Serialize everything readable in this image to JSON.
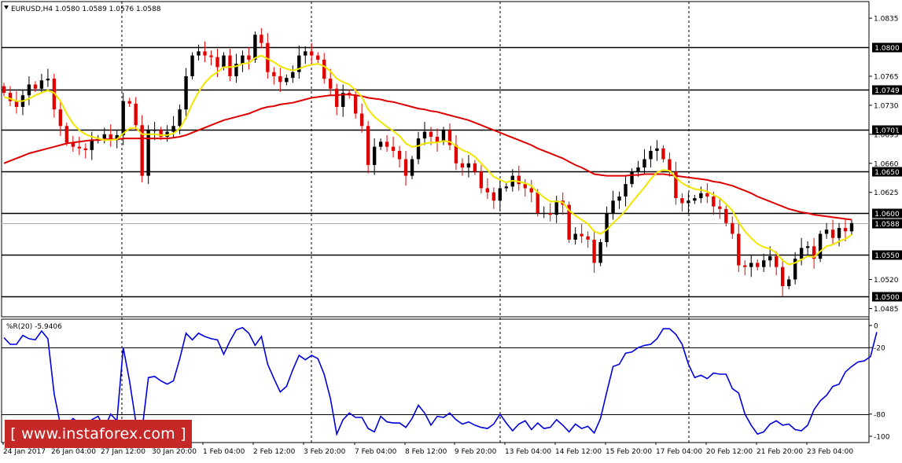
{
  "chart_data": [
    {
      "type": "candlestick",
      "header": "EURUSD,H4  1.0580 1.0589 1.0576 1.0588",
      "symbol": "EURUSD",
      "timeframe": "H4",
      "last_bar": {
        "open": 1.058,
        "high": 1.0589,
        "low": 1.0576,
        "close": 1.0588
      },
      "ylim": [
        1.0475,
        1.0855
      ],
      "y_ticks": [
        "1.0835",
        "1.0765",
        "1.0730",
        "1.0695",
        "1.0660",
        "1.0625",
        "1.0520",
        "1.0485"
      ],
      "x_ticks": [
        "24 Jan 2017",
        "26 Jan 04:00",
        "27 Jan 12:00",
        "30 Jan 20:00",
        "1 Feb 04:00",
        "2 Feb 12:00",
        "3 Feb 20:00",
        "7 Feb 04:00",
        "8 Feb 12:00",
        "9 Feb 20:00",
        "13 Feb 04:00",
        "14 Feb 12:00",
        "15 Feb 20:00",
        "17 Feb 04:00",
        "20 Feb 12:00",
        "21 Feb 20:00",
        "23 Feb 04:00"
      ],
      "horizontal_levels": [
        "1.0800",
        "1.0749",
        "1.0701",
        "1.0650",
        "1.0600",
        "1.0550",
        "1.0500"
      ],
      "current_price": "1.0588",
      "up_color": "#000000",
      "down_color": "#e00000",
      "fast_ma_color": "#f2e600",
      "slow_ma_color": "#dd0000",
      "grid": false,
      "close": [
        1.0745,
        1.0735,
        1.0728,
        1.0742,
        1.0755,
        1.075,
        1.076,
        1.0762,
        1.0725,
        1.0705,
        1.0685,
        1.068,
        1.0678,
        1.0676,
        1.0688,
        1.069,
        1.0695,
        1.0688,
        1.0694,
        1.0735,
        1.0732,
        1.0706,
        1.0645,
        1.07,
        1.07,
        1.0692,
        1.0698,
        1.0705,
        1.0725,
        1.0765,
        1.079,
        1.0795,
        1.079,
        1.0788,
        1.0776,
        1.079,
        1.0765,
        1.078,
        1.079,
        1.0785,
        1.0815,
        1.0805,
        1.077,
        1.0765,
        1.0758,
        1.0763,
        1.077,
        1.079,
        1.0795,
        1.079,
        1.0785,
        1.0762,
        1.075,
        1.0728,
        1.0745,
        1.0742,
        1.072,
        1.0705,
        1.0658,
        1.068,
        1.0686,
        1.068,
        1.0675,
        1.0665,
        1.0645,
        1.0665,
        1.069,
        1.0698,
        1.0692,
        1.0686,
        1.07,
        1.0682,
        1.066,
        1.0655,
        1.066,
        1.065,
        1.063,
        1.0625,
        1.0615,
        1.063,
        1.0632,
        1.0645,
        1.0635,
        1.063,
        1.0625,
        1.06,
        1.06,
        1.0598,
        1.0615,
        1.061,
        1.0568,
        1.0575,
        1.0572,
        1.0568,
        1.054,
        1.0565,
        1.06,
        1.0615,
        1.062,
        1.0635,
        1.065,
        1.0655,
        1.0665,
        1.0675,
        1.0678,
        1.0665,
        1.065,
        1.0618,
        1.0612,
        1.0615,
        1.0618,
        1.0624,
        1.062,
        1.0608,
        1.0605,
        1.0588,
        1.0575,
        1.0537,
        1.0535,
        1.054,
        1.0535,
        1.0543,
        1.0548,
        1.0535,
        1.0512,
        1.052,
        1.0545,
        1.0558,
        1.056,
        1.0545,
        1.0575,
        1.058,
        1.057,
        1.0582,
        1.0578,
        1.0588
      ],
      "fast_ma": [
        1.074,
        1.0738,
        1.0735,
        1.0735,
        1.0738,
        1.0742,
        1.0745,
        1.0748,
        1.0745,
        1.0735,
        1.072,
        1.0708,
        1.07,
        1.0695,
        1.0692,
        1.069,
        1.0688,
        1.0688,
        1.0689,
        1.0696,
        1.0702,
        1.0703,
        1.0695,
        1.0695,
        1.0695,
        1.0694,
        1.0694,
        1.0696,
        1.0702,
        1.0715,
        1.0732,
        1.0746,
        1.0757,
        1.0765,
        1.077,
        1.0776,
        1.0776,
        1.0777,
        1.078,
        1.0781,
        1.0787,
        1.079,
        1.0786,
        1.0782,
        1.0777,
        1.0774,
        1.0772,
        1.0774,
        1.0777,
        1.0779,
        1.078,
        1.0777,
        1.0771,
        1.0762,
        1.0758,
        1.0755,
        1.0748,
        1.074,
        1.0725,
        1.0716,
        1.071,
        1.0704,
        1.0699,
        1.0693,
        1.0684,
        1.068,
        1.0681,
        1.0684,
        1.0685,
        1.0685,
        1.0687,
        1.0686,
        1.0681,
        1.0676,
        1.0673,
        1.0668,
        1.066,
        1.0652,
        1.0644,
        1.064,
        1.0637,
        1.0639,
        1.0638,
        1.0636,
        1.0633,
        1.0625,
        1.0619,
        1.0614,
        1.0614,
        1.0613,
        1.0603,
        1.0597,
        1.0592,
        1.0587,
        1.0578,
        1.0575,
        1.058,
        1.0588,
        1.0595,
        1.0603,
        1.0613,
        1.0622,
        1.0631,
        1.0641,
        1.0649,
        1.0652,
        1.0651,
        1.0643,
        1.0636,
        1.0632,
        1.0629,
        1.0628,
        1.0626,
        1.0622,
        1.0618,
        1.0611,
        1.0603,
        1.0589,
        1.0578,
        1.057,
        1.0563,
        1.0559,
        1.0557,
        1.0552,
        1.0543,
        1.0538,
        1.054,
        1.0544,
        1.0548,
        1.0547,
        1.0554,
        1.056,
        1.0562,
        1.0566,
        1.0569,
        1.0574
      ],
      "slow_ma": [
        1.066,
        1.0663,
        1.0666,
        1.0669,
        1.0672,
        1.0674,
        1.0676,
        1.0678,
        1.068,
        1.0682,
        1.0684,
        1.0685,
        1.0686,
        1.0687,
        1.0688,
        1.0688,
        1.0689,
        1.0689,
        1.0689,
        1.069,
        1.069,
        1.069,
        1.069,
        1.069,
        1.069,
        1.069,
        1.069,
        1.0691,
        1.0692,
        1.0694,
        1.0697,
        1.07,
        1.0703,
        1.0706,
        1.0709,
        1.0712,
        1.0714,
        1.0716,
        1.0718,
        1.072,
        1.0723,
        1.0726,
        1.0728,
        1.0729,
        1.0731,
        1.0732,
        1.0733,
        1.0735,
        1.0737,
        1.0739,
        1.074,
        1.0741,
        1.0742,
        1.0742,
        1.0743,
        1.0743,
        1.0742,
        1.0741,
        1.0739,
        1.0738,
        1.0737,
        1.0735,
        1.0734,
        1.0732,
        1.073,
        1.0728,
        1.0726,
        1.0725,
        1.0723,
        1.0722,
        1.072,
        1.0718,
        1.0716,
        1.0714,
        1.0712,
        1.0709,
        1.0706,
        1.0703,
        1.07,
        1.0697,
        1.0694,
        1.0691,
        1.0688,
        1.0685,
        1.0682,
        1.0678,
        1.0675,
        1.0672,
        1.0669,
        1.0666,
        1.0662,
        1.0658,
        1.0655,
        1.0651,
        1.0647,
        1.0646,
        1.0645,
        1.0645,
        1.0645,
        1.0645,
        1.0646,
        1.0646,
        1.0647,
        1.0647,
        1.0647,
        1.0647,
        1.0646,
        1.0645,
        1.0644,
        1.0643,
        1.0642,
        1.0641,
        1.064,
        1.0638,
        1.0637,
        1.0635,
        1.0633,
        1.063,
        1.0627,
        1.0624,
        1.062,
        1.0617,
        1.0614,
        1.0611,
        1.0608,
        1.0605,
        1.0603,
        1.0601,
        1.06,
        1.0598,
        1.0597,
        1.0596,
        1.0595,
        1.0594,
        1.0593,
        1.0592
      ]
    },
    {
      "type": "line",
      "header": "%R(20) -5.9406",
      "name": "%R(20)",
      "ylim": [
        -100,
        0
      ],
      "y_ticks": [
        "0",
        "-20",
        "-80",
        "-100"
      ],
      "levels": [
        -20,
        -80
      ],
      "color": "#0000dd",
      "values": [
        -11,
        -17,
        -17,
        -9,
        -12,
        -13,
        -5,
        -12,
        -62,
        -90,
        -90,
        -84,
        -88,
        -94,
        -85,
        -82,
        -93,
        -80,
        -86,
        -20,
        -50,
        -87,
        -94,
        -47,
        -46,
        -50,
        -53,
        -50,
        -30,
        -7,
        -13,
        -7,
        -10,
        -12,
        -13,
        -26,
        -14,
        -4,
        -2,
        -7,
        -18,
        -10,
        -35,
        -48,
        -60,
        -55,
        -40,
        -27,
        -31,
        -27,
        -30,
        -44,
        -66,
        -98,
        -85,
        -79,
        -83,
        -83,
        -93,
        -96,
        -82,
        -87,
        -88,
        -88,
        -92,
        -84,
        -72,
        -79,
        -90,
        -82,
        -83,
        -79,
        -85,
        -89,
        -87,
        -90,
        -92,
        -93,
        -89,
        -80,
        -88,
        -95,
        -89,
        -86,
        -94,
        -88,
        -93,
        -92,
        -85,
        -90,
        -96,
        -89,
        -93,
        -91,
        -97,
        -84,
        -60,
        -37,
        -35,
        -25,
        -24,
        -20,
        -18,
        -17,
        -12,
        -3,
        -3,
        -8,
        -17,
        -35,
        -47,
        -45,
        -48,
        -43,
        -44,
        -44,
        -57,
        -61,
        -80,
        -90,
        -98,
        -96,
        -89,
        -86,
        -90,
        -89,
        -94,
        -95,
        -90,
        -76,
        -68,
        -63,
        -55,
        -53,
        -42,
        -37,
        -33,
        -32,
        -28,
        -6
      ]
    }
  ],
  "watermark": "[ www.instaforex.com ]"
}
